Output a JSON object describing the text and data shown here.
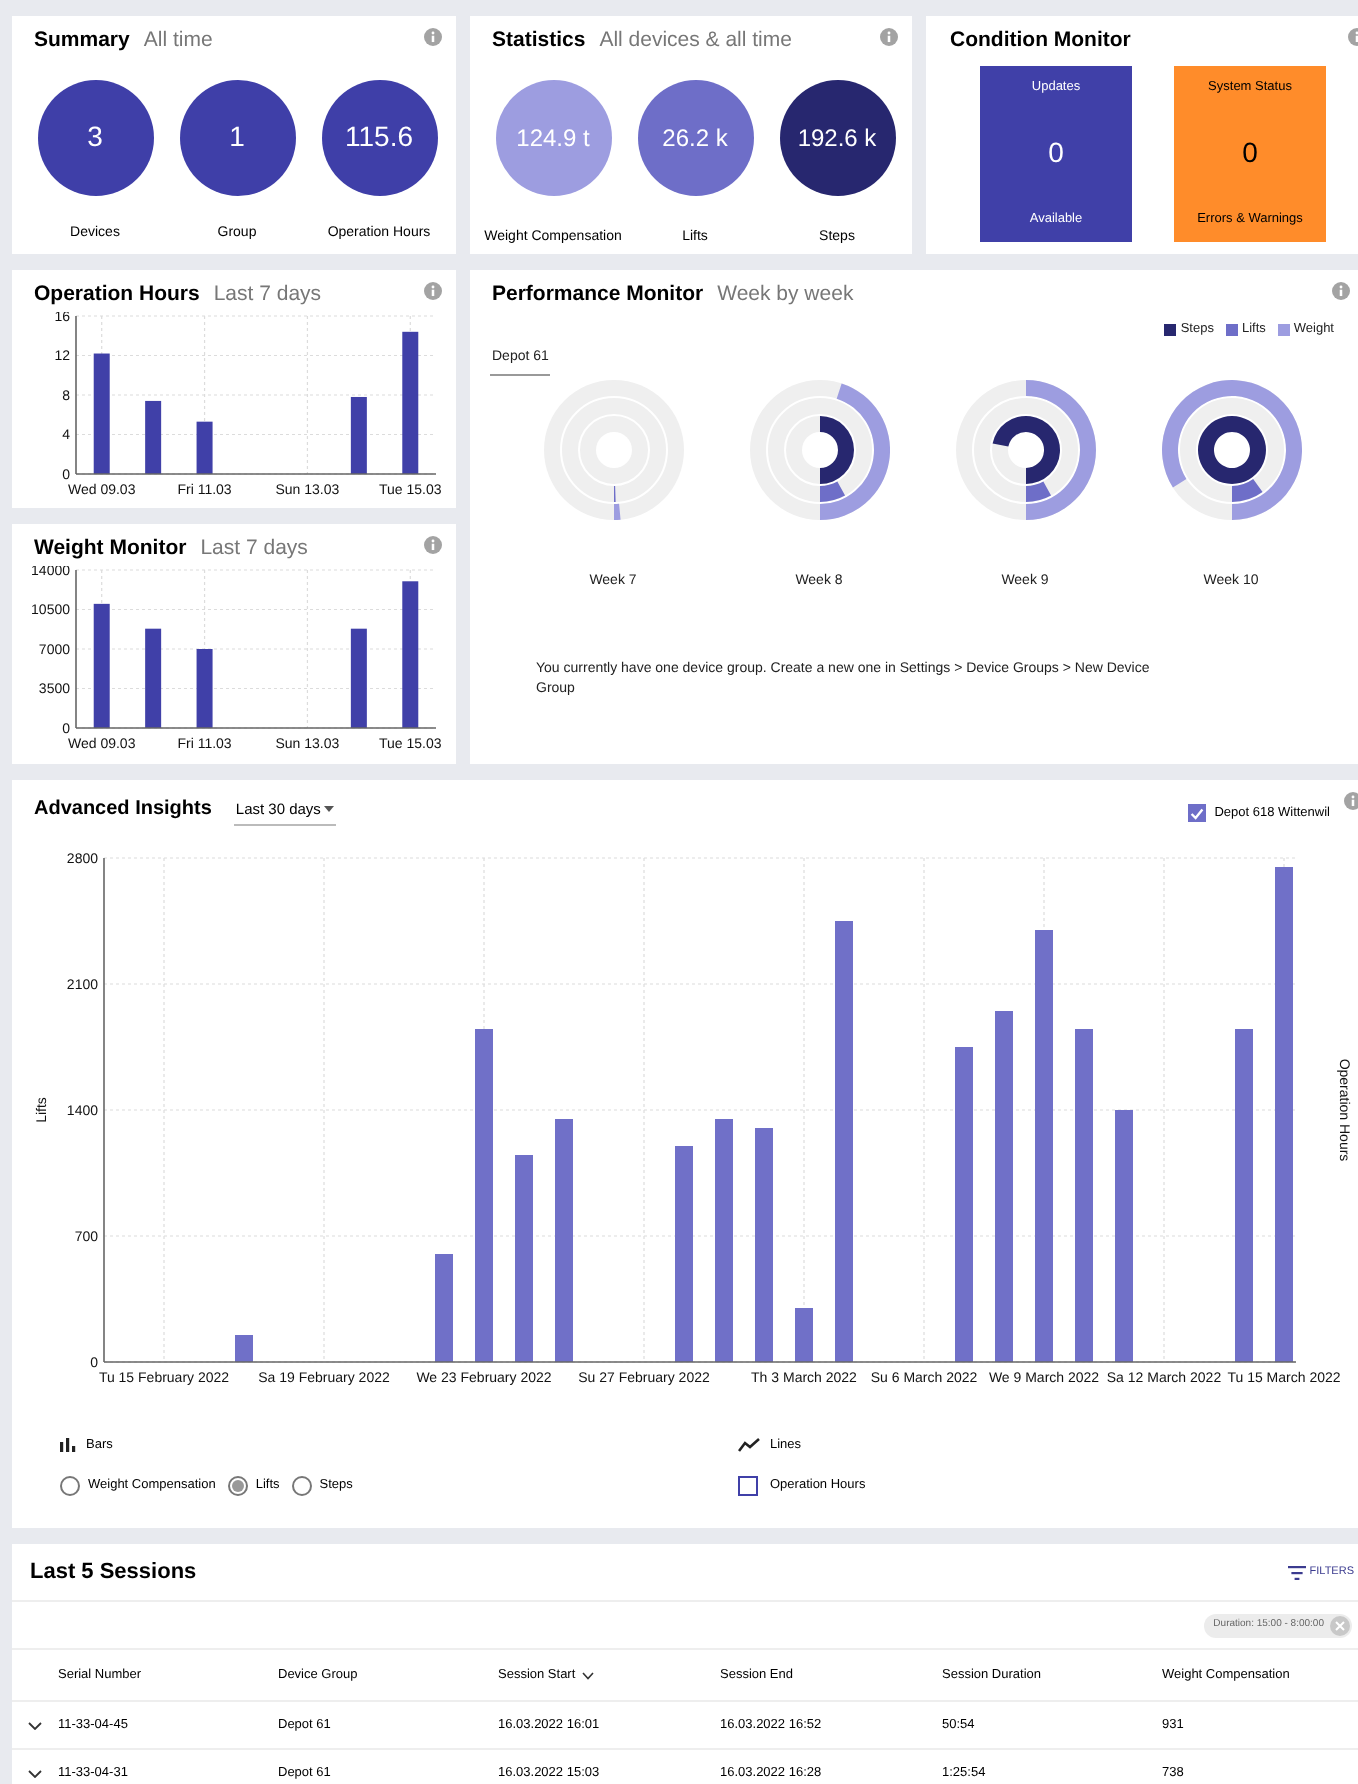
{
  "summary": {
    "title": "Summary",
    "subtitle": "All time",
    "items": [
      {
        "value": "3",
        "label": "Devices"
      },
      {
        "value": "1",
        "label": "Group"
      },
      {
        "value": "115.6",
        "label": "Operation Hours"
      }
    ]
  },
  "statistics": {
    "title": "Statistics",
    "subtitle": "All devices & all time",
    "items": [
      {
        "value": "124.9 t",
        "label": "Weight Compensation",
        "color": "#9d9de0"
      },
      {
        "value": "26.2 k",
        "label": "Lifts",
        "color": "#6e6ec8"
      },
      {
        "value": "192.6 k",
        "label": "Steps",
        "color": "#27276f"
      }
    ]
  },
  "condition_monitor": {
    "title": "Condition Monitor",
    "tiles": [
      {
        "heading": "Updates",
        "value": "0",
        "caption": "Available",
        "color": "#4040a8"
      },
      {
        "heading": "System Status",
        "value": "0",
        "caption": "Errors & Warnings",
        "color": "#ff8c2a"
      }
    ]
  },
  "operation_hours": {
    "title": "Operation Hours",
    "subtitle": "Last 7 days",
    "chart_data": {
      "type": "bar",
      "categories": [
        "Wed 09.03",
        null,
        "Fri 11.03",
        null,
        "Sun 13.03",
        null,
        "Tue 15.03"
      ],
      "series": [
        {
          "color": "#4040a8",
          "values": [
            12.2,
            7.4,
            5.3,
            0,
            0,
            7.8,
            14.4
          ]
        }
      ],
      "ylim": [
        0,
        16
      ],
      "yticks": [
        0,
        4,
        8,
        12,
        16
      ],
      "grid": true
    }
  },
  "weight_monitor": {
    "title": "Weight Monitor",
    "subtitle": "Last 7 days",
    "chart_data": {
      "type": "bar",
      "categories": [
        "Wed 09.03",
        null,
        "Fri 11.03",
        null,
        "Sun 13.03",
        null,
        "Tue 15.03"
      ],
      "series": [
        {
          "color": "#4040a8",
          "values": [
            11000,
            8800,
            7000,
            0,
            0,
            8800,
            13000
          ]
        }
      ],
      "ylim": [
        0,
        14000
      ],
      "yticks": [
        0,
        3500,
        7000,
        10500,
        14000
      ],
      "grid": true
    }
  },
  "performance_monitor": {
    "title": "Performance Monitor",
    "subtitle": "Week by week",
    "tabs": [
      {
        "label": "Depot 61",
        "selected": true
      }
    ],
    "legend": [
      {
        "label": "Steps",
        "color": "#27276f"
      },
      {
        "label": "Lifts",
        "color": "#6e6ec8"
      },
      {
        "label": "Weight",
        "color": "#9d9de0"
      }
    ],
    "weeks": [
      {
        "label": "Week 7"
      },
      {
        "label": "Week 8"
      },
      {
        "label": "Week 9"
      },
      {
        "label": "Week 10"
      }
    ],
    "note": "You currently have one device group. Create a new one in Settings > Device Groups > New Device Group"
  },
  "advanced_insights": {
    "title": "Advanced Insights",
    "range_dropdown": {
      "value": "Last 30 days"
    },
    "depot_filter": {
      "label": "Depot 618 Wittenwil",
      "checked": true
    },
    "right_axis_label": "Operation Hours",
    "chart_data": {
      "type": "bar",
      "ylabel": "Lifts",
      "categories": [
        "Tu 15 February 2022",
        null,
        null,
        null,
        "Sa 19 February 2022",
        null,
        null,
        null,
        "We 23 February 2022",
        null,
        null,
        null,
        "Su 27 February 2022",
        null,
        null,
        null,
        "Th 3 March 2022",
        null,
        null,
        "Su 6 March 2022",
        null,
        null,
        "We 9 March 2022",
        null,
        null,
        "Sa 12 March 2022",
        null,
        null,
        "Tu 15 March 2022"
      ],
      "series": [
        {
          "color": "#7070c8",
          "values": [
            0,
            0,
            150,
            0,
            0,
            0,
            0,
            600,
            1850,
            1150,
            1350,
            0,
            0,
            1200,
            1350,
            1300,
            300,
            2450,
            0,
            0,
            1750,
            1950,
            2400,
            1850,
            1400,
            0,
            0,
            1850,
            2750
          ]
        }
      ],
      "ylim": [
        0,
        2800
      ],
      "yticks": [
        0,
        700,
        1400,
        2100,
        2800
      ],
      "grid": true
    },
    "bars_legend": {
      "label": "Bars",
      "options": [
        {
          "label": "Weight Compensation",
          "selected": false
        },
        {
          "label": "Lifts",
          "selected": true
        },
        {
          "label": "Steps",
          "selected": false
        }
      ]
    },
    "lines_legend": {
      "label": "Lines",
      "options": [
        {
          "label": "Operation Hours",
          "checked": false
        }
      ]
    }
  },
  "sessions": {
    "title": "Last 5 Sessions",
    "filters_button": "FILTERS",
    "filter_chips": [
      {
        "label": "Duration: 15:00 - 8:00:00"
      }
    ],
    "columns": [
      {
        "label": "Serial Number",
        "sorted": false
      },
      {
        "label": "Device Group",
        "sorted": false
      },
      {
        "label": "Session Start",
        "sorted": true
      },
      {
        "label": "Session End",
        "sorted": false
      },
      {
        "label": "Session Duration",
        "sorted": false
      },
      {
        "label": "Weight Compensation",
        "sorted": false
      }
    ],
    "rows": [
      {
        "expanded": false,
        "cells": [
          "11-33-04-45",
          "Depot 61",
          "16.03.2022 16:01",
          "16.03.2022 16:52",
          "50:54",
          "931"
        ]
      },
      {
        "expanded": false,
        "cells": [
          "11-33-04-31",
          "Depot 61",
          "16.03.2022 15:03",
          "16.03.2022 16:28",
          "1:25:54",
          "738"
        ]
      }
    ]
  }
}
